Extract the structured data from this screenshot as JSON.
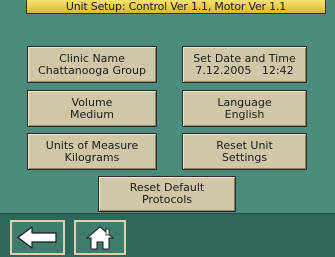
{
  "header": {
    "title": "Unit Setup: Control Ver 1.1, Motor Ver 1.1"
  },
  "buttons": {
    "clinic_name": {
      "label": "Clinic Name",
      "value": "Chattanooga Group"
    },
    "set_date_time": {
      "label": "Set Date and Time",
      "value": "7.12.2005   12:42"
    },
    "volume": {
      "label": "Volume",
      "value": "Medium"
    },
    "language": {
      "label": "Language",
      "value": "English"
    },
    "units_of_measure": {
      "label": "Units of Measure",
      "value": "Kilograms"
    },
    "reset_unit_settings": {
      "line1": "Reset Unit",
      "line2": "Settings"
    },
    "reset_default_protocols": {
      "line1": "Reset Default",
      "line2": "Protocols"
    }
  },
  "nav": {
    "back_icon": "back-arrow-icon",
    "home_icon": "home-icon"
  },
  "colors": {
    "background": "#4d8c7c",
    "title_bar": "#e8cc50",
    "button_face": "#cfc7a6",
    "bottom_bar": "#2f6759"
  }
}
